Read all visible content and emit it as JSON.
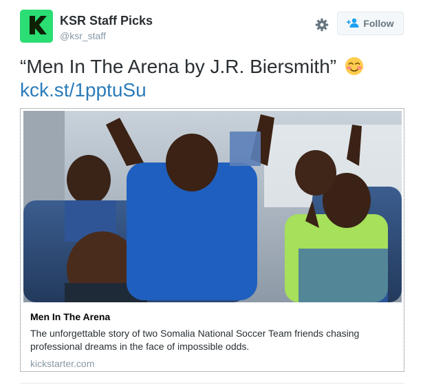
{
  "account": {
    "display_name": "KSR Staff Picks",
    "handle": "@ksr_staff",
    "avatar_icon": "kickstarter-k-logo",
    "avatar_color": "#2bde73"
  },
  "actions": {
    "settings_icon": "gear-icon",
    "follow_label": "Follow",
    "follow_icon": "add-user-icon"
  },
  "tweet": {
    "text": "“Men In The Arena by J.R. Biersmith”",
    "emoji": "smiling-face-with-blush-icon",
    "link_text": "kck.st/1pptuSu",
    "link_color": "#2b7bb9"
  },
  "card": {
    "image_subject": "soccer players cheering on a bus",
    "title": "Men In The Arena",
    "description": "The unforgettable story of two Somalia National Soccer Team friends chasing professional dreams in the face of impossible odds.",
    "domain": "kickstarter.com"
  }
}
